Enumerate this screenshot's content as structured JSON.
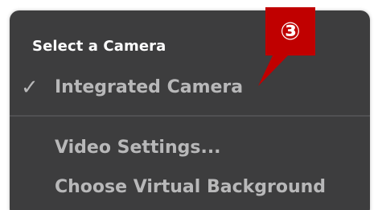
{
  "menu": {
    "header": "Select a Camera",
    "items": [
      {
        "label": "Integrated Camera",
        "checked": true
      },
      {
        "label": "Video Settings..."
      },
      {
        "label": "Choose Virtual Background"
      }
    ],
    "check_icon": "✓",
    "background_color": "#3d3d3e",
    "text_color": "#b8b8b9"
  },
  "callout": {
    "number": "③",
    "color": "#c00000"
  }
}
